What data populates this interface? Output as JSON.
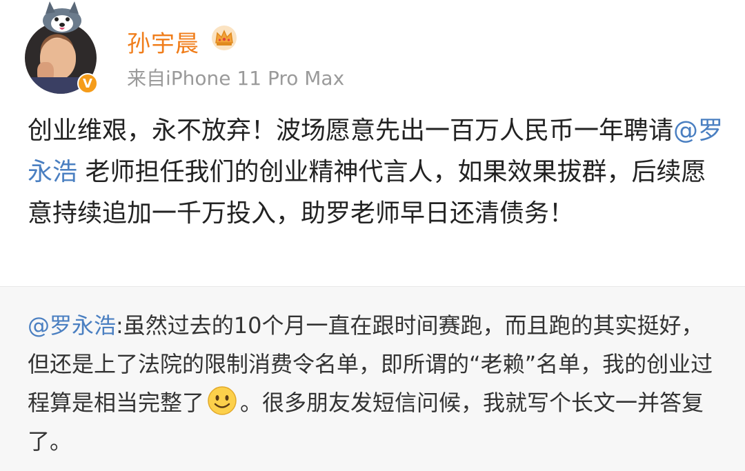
{
  "post": {
    "author": "孙宇晨",
    "source": "来自iPhone 11 Pro Max",
    "text_before_mention": "创业维艰，永不放弃！波场愿意先出一百万人民币一年聘请",
    "mention": "@罗永浩",
    "text_after_mention": " 老师担任我们的创业精神代言人，如果效果拔群，后续愿意持续追加一千万投入，助罗老师早日还清债务！",
    "badge_icon": "verified-badge-icon",
    "crown_icon": "crown-icon"
  },
  "repost": {
    "mention": "@罗永浩",
    "text_before_emoji": ":虽然过去的10个月一直在跟时间赛跑，而且跑的其实挺好，但还是上了法院的限制消费令名单，即所谓的“老赖”名单，我的创业过程算是相当完整了",
    "emoji": "smile-emoji",
    "text_after_emoji": "。很多朋友发短信问候，我就写个长文一并答复了。"
  },
  "colors": {
    "author": "#f07d1a",
    "mention": "#4a7fc1",
    "source": "#9a9a9a",
    "repost_bg": "#f7f7f7"
  }
}
